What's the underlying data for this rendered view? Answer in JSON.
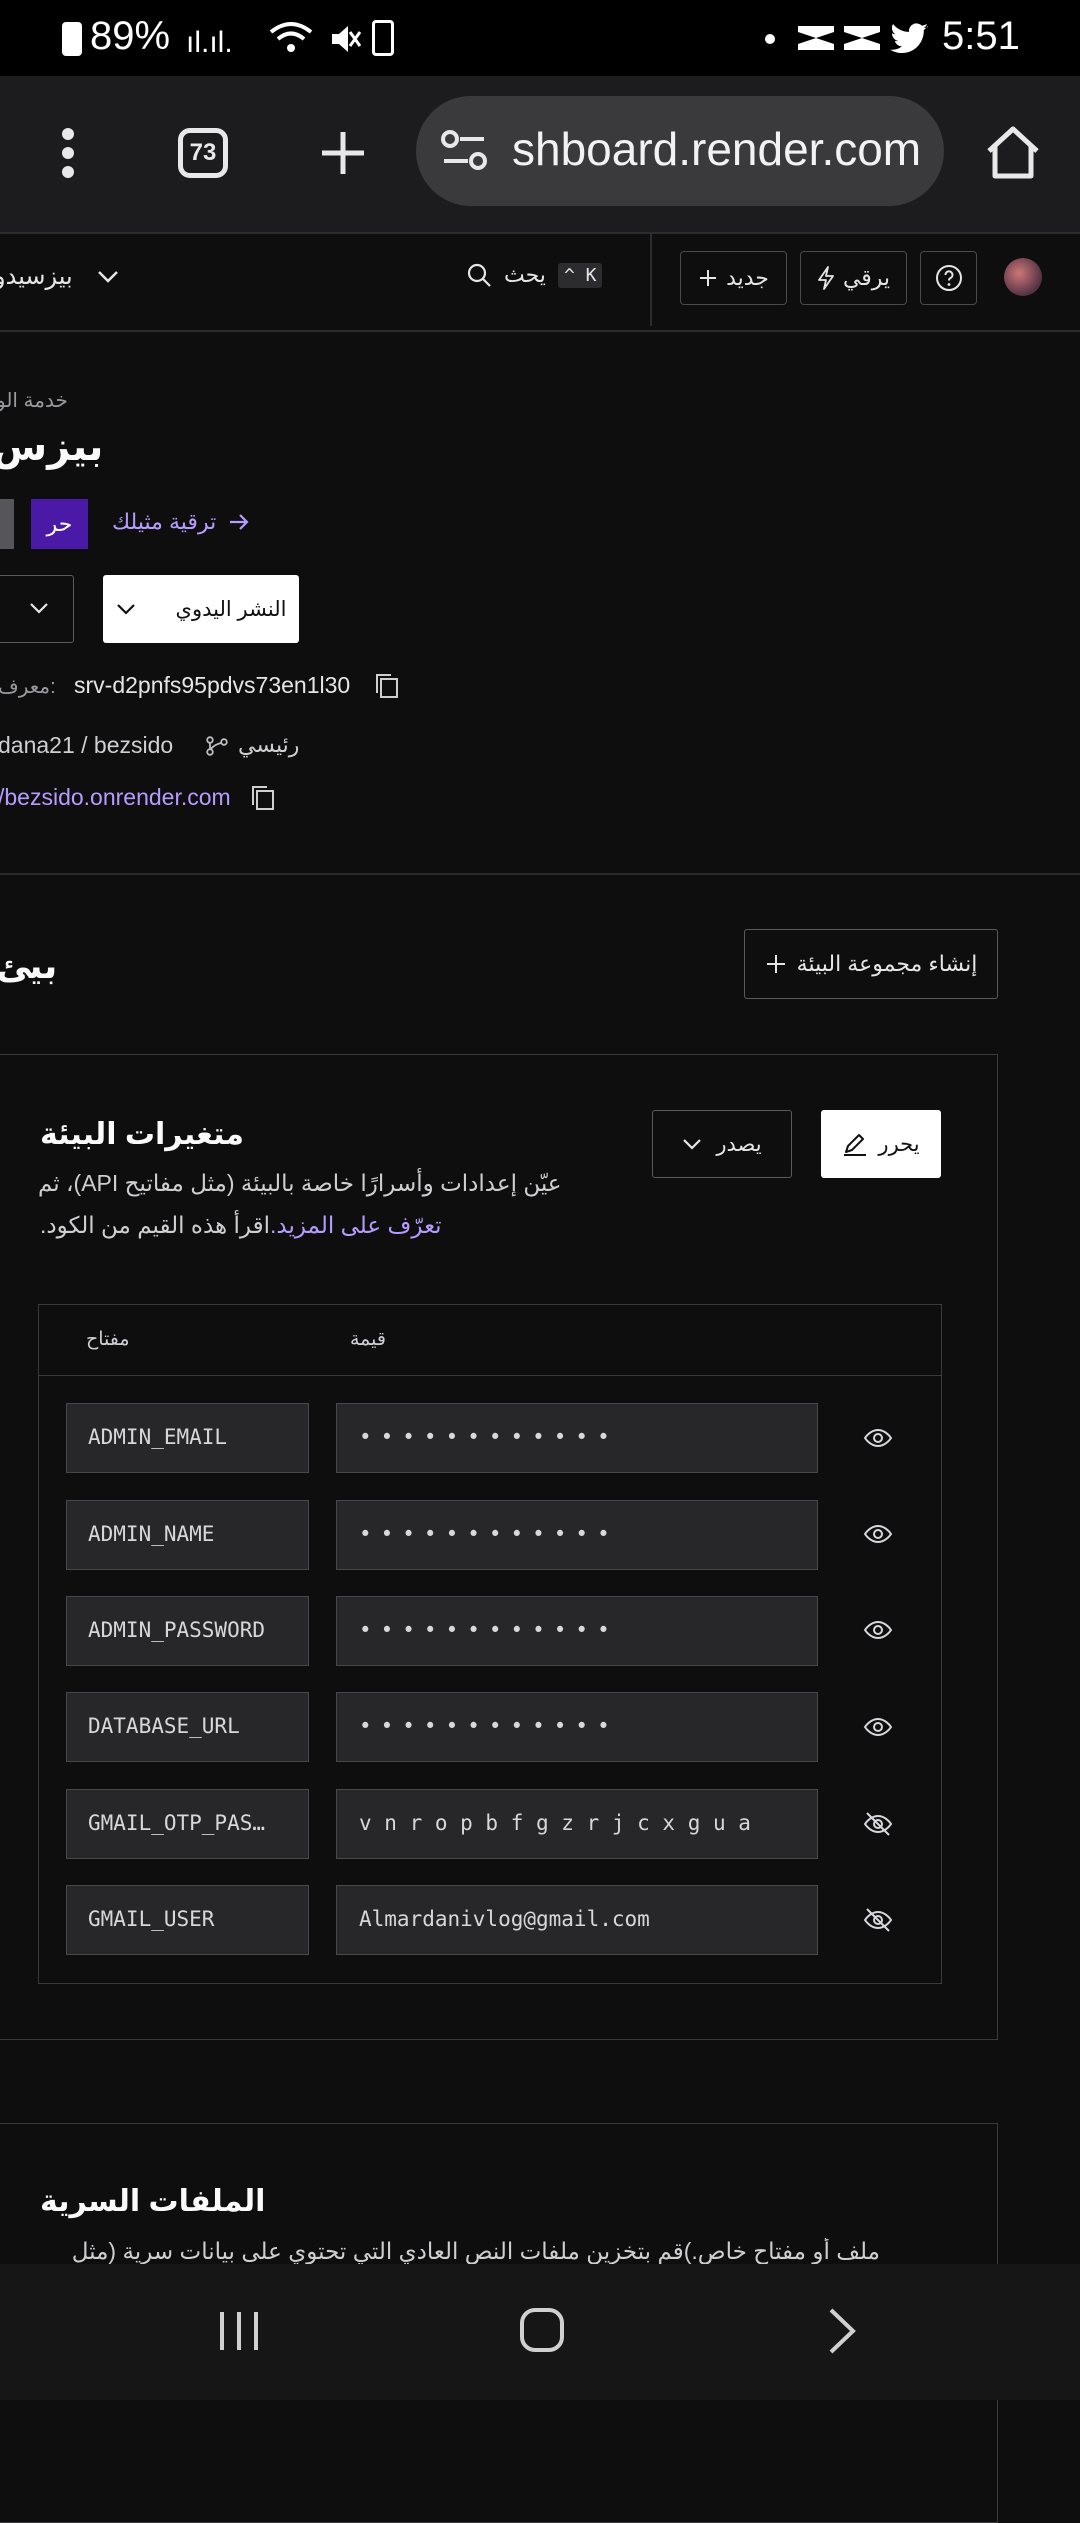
{
  "status_bar": {
    "battery_percent": "89%",
    "time": "5:51"
  },
  "browser": {
    "url_visible": "shboard.render.com",
    "tab_count": "73"
  },
  "nav": {
    "workspace": "بيزسيدو",
    "search_label": "يحث",
    "search_shortcut": "^ K",
    "new_label": "جديد",
    "upgrade_label": "يرقي"
  },
  "service": {
    "breadcrumb": "خدمة الو",
    "name": "بيزس",
    "plan_badge": "حر",
    "upgrade_link": "ترقية مثيلك",
    "manual_deploy": "النشر اليدوي",
    "id_label": "معرف:",
    "id_value": "srv-d2pnfs95pdvs73en1l30",
    "repo": "dana21 / bezsido",
    "branch": "رئيسي",
    "url": "/bezsido.onrender.com"
  },
  "env_section": {
    "title_partial": "بيئ",
    "create_group_button": "إنشاء مجموعة البيئة"
  },
  "env_vars": {
    "title": "متغيرات البيئة",
    "edit_button": "يحرر",
    "export_button": "يصدر",
    "description_line1": "عيّن إعدادات وأسرارًا خاصة بالبيئة (مثل مفاتيح API)، ثم",
    "learn_more": "تعرّف على المزيد.",
    "description_line2_rest": "اقرأ هذه القيم من الكود.",
    "columns": {
      "key": "مفتاح",
      "value": "قيمة"
    },
    "rows": [
      {
        "key": "ADMIN_EMAIL",
        "value": "••••••••••••",
        "masked": true
      },
      {
        "key": "ADMIN_NAME",
        "value": "••••••••••••",
        "masked": true
      },
      {
        "key": "ADMIN_PASSWORD",
        "value": "••••••••••••",
        "masked": true
      },
      {
        "key": "DATABASE_URL",
        "value": "••••••••••••",
        "masked": true
      },
      {
        "key": "GMAIL_OTP_PAS…",
        "value": "v n r o p b f g z r j c x g u a",
        "masked": false
      },
      {
        "key": "GMAIL_USER",
        "value": "Almardanivlog@gmail.com",
        "masked": false
      }
    ]
  },
  "secret_files": {
    "title": "الملفات السرية",
    "description": "ملف أو مفتاح خاص.)قم بتخزين ملفات النص العادي التي تحتوي على بيانات سرية (مثل"
  }
}
